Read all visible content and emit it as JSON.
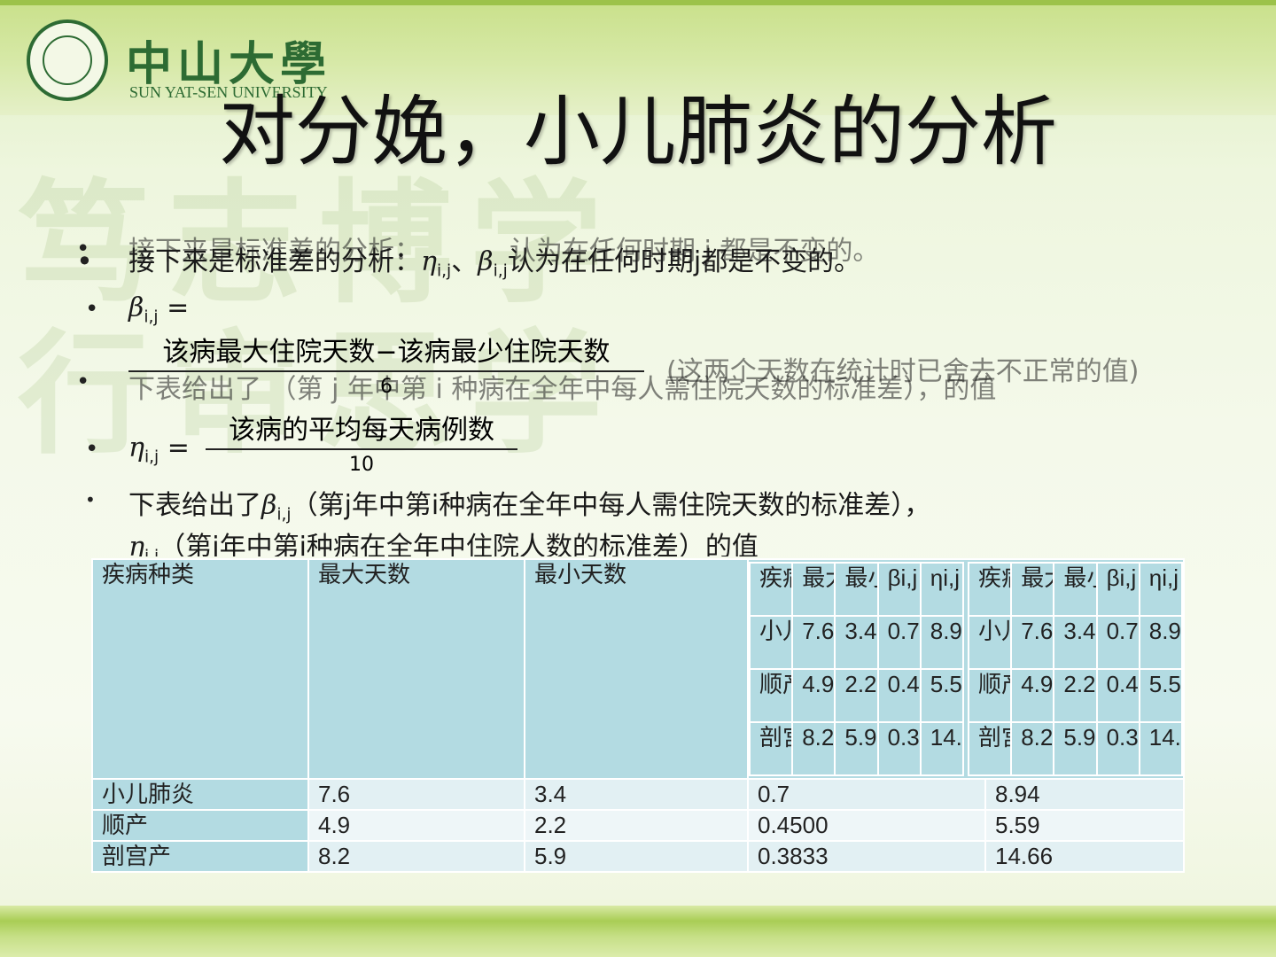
{
  "logo": {
    "cn": "中山大學",
    "en": "SUN YAT-SEN UNIVERSITY"
  },
  "title": "对分娩，小儿肺炎的分析",
  "ghost": {
    "line1": "接下来是标准差的分析：",
    "line1b": "认为在任何时期 j 都是不变的。",
    "line2": "下表给出了 （第 j 年中第 i 种病在全年中每人需住院天数的标准差），的值",
    "paren": "(这两个天数在统计时已舍去不正常的值)"
  },
  "main": {
    "line1_a": "接下来是标准差的分析：",
    "eta": "η",
    "beta": "β",
    "sub_ij": "i,j",
    "sep": "、",
    "line1_b": "认为在任何时期j都是不变的。",
    "beta_eq": "=",
    "beta_num": "该病最大住院天数−该病最少住院天数",
    "beta_den": "6",
    "eta_eq": "=",
    "eta_num": "该病的平均每天病例数",
    "eta_den": "10",
    "last_a": "下表给出了",
    "last_b": "（第j年中第i种病在全年中每人需住院天数的标准差），",
    "last_c": "（第j年中第i种病在全年中住院人数的标准差）的值",
    "bullet": "•"
  },
  "table": {
    "headers": [
      "疾病种类",
      "最大天数",
      "最小天数"
    ],
    "rows": [
      [
        "小儿肺炎",
        "7.6",
        "3.4",
        "0.7",
        "8.94"
      ],
      [
        "顺产",
        "4.9",
        "2.2",
        "0.4500",
        "5.59"
      ],
      [
        "剖宫产",
        "8.2",
        "5.9",
        "0.3833",
        "14.66"
      ]
    ],
    "mini_headers": [
      "疾病种类",
      "最大天数",
      "最小天数",
      "βi,j",
      "ηi,j"
    ]
  },
  "colors": {
    "header_cell": "#b3dbe2",
    "body_cell": "#e2f0f3",
    "accent_green": "#2d6b33"
  }
}
